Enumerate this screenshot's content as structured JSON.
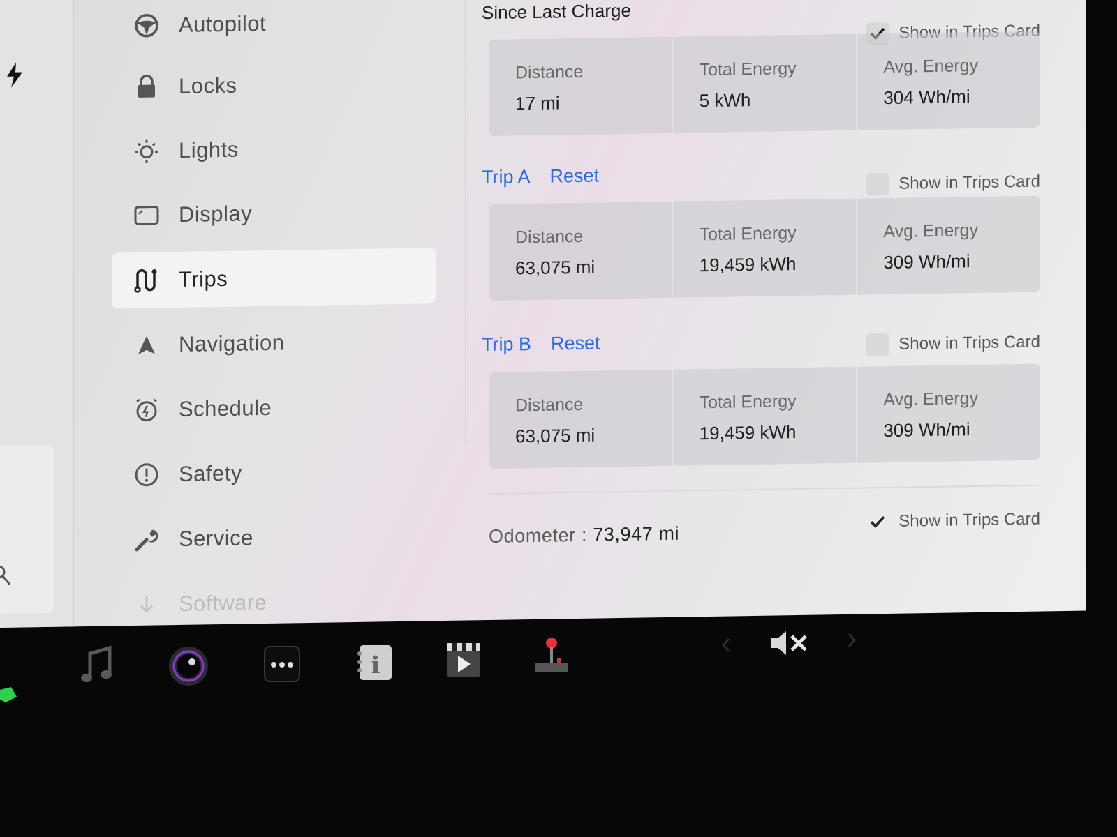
{
  "sidebar": {
    "items": [
      {
        "label": "Autopilot",
        "icon": "steering-wheel-icon",
        "active": false
      },
      {
        "label": "Locks",
        "icon": "lock-icon",
        "active": false
      },
      {
        "label": "Lights",
        "icon": "light-bulb-icon",
        "active": false
      },
      {
        "label": "Display",
        "icon": "display-icon",
        "active": false
      },
      {
        "label": "Trips",
        "icon": "trips-route-icon",
        "active": true
      },
      {
        "label": "Navigation",
        "icon": "navigation-arrow-icon",
        "active": false
      },
      {
        "label": "Schedule",
        "icon": "alarm-clock-icon",
        "active": false
      },
      {
        "label": "Safety",
        "icon": "exclamation-circle-icon",
        "active": false
      },
      {
        "label": "Service",
        "icon": "wrench-icon",
        "active": false
      },
      {
        "label": "Software",
        "icon": "download-arrow-icon",
        "active": false
      }
    ]
  },
  "since_last_charge": {
    "title": "Since Last Charge",
    "show_in_trips_card": {
      "label": "Show in Trips Card",
      "checked": true
    },
    "distance": {
      "label": "Distance",
      "value": "17 mi"
    },
    "total_energy": {
      "label": "Total Energy",
      "value": "5 kWh"
    },
    "avg_energy": {
      "label": "Avg. Energy",
      "value": "304 Wh/mi"
    }
  },
  "trip_a": {
    "title": "Trip A",
    "reset_label": "Reset",
    "show_in_trips_card": {
      "label": "Show in Trips Card",
      "checked": false
    },
    "distance": {
      "label": "Distance",
      "value": "63,075 mi"
    },
    "total_energy": {
      "label": "Total Energy",
      "value": "19,459 kWh"
    },
    "avg_energy": {
      "label": "Avg. Energy",
      "value": "309 Wh/mi"
    }
  },
  "trip_b": {
    "title": "Trip B",
    "reset_label": "Reset",
    "show_in_trips_card": {
      "label": "Show in Trips Card",
      "checked": false
    },
    "distance": {
      "label": "Distance",
      "value": "63,075 mi"
    },
    "total_energy": {
      "label": "Total Energy",
      "value": "19,459 kWh"
    },
    "avg_energy": {
      "label": "Avg. Energy",
      "value": "309 Wh/mi"
    }
  },
  "odometer": {
    "label": "Odometer",
    "separator": ":",
    "value": "73,947 mi",
    "show_in_trips_card": {
      "label": "Show in Trips Card",
      "checked": true
    }
  },
  "dock": {
    "apps": [
      "music-note-icon",
      "camera-icon",
      "more-apps-icon",
      "manual-info-icon",
      "theater-clapper-icon",
      "arcade-joystick-icon"
    ],
    "volume": "volume-muted-icon"
  },
  "colors": {
    "accent": "#2f6ad8",
    "charging_green": "#2bd24a"
  }
}
